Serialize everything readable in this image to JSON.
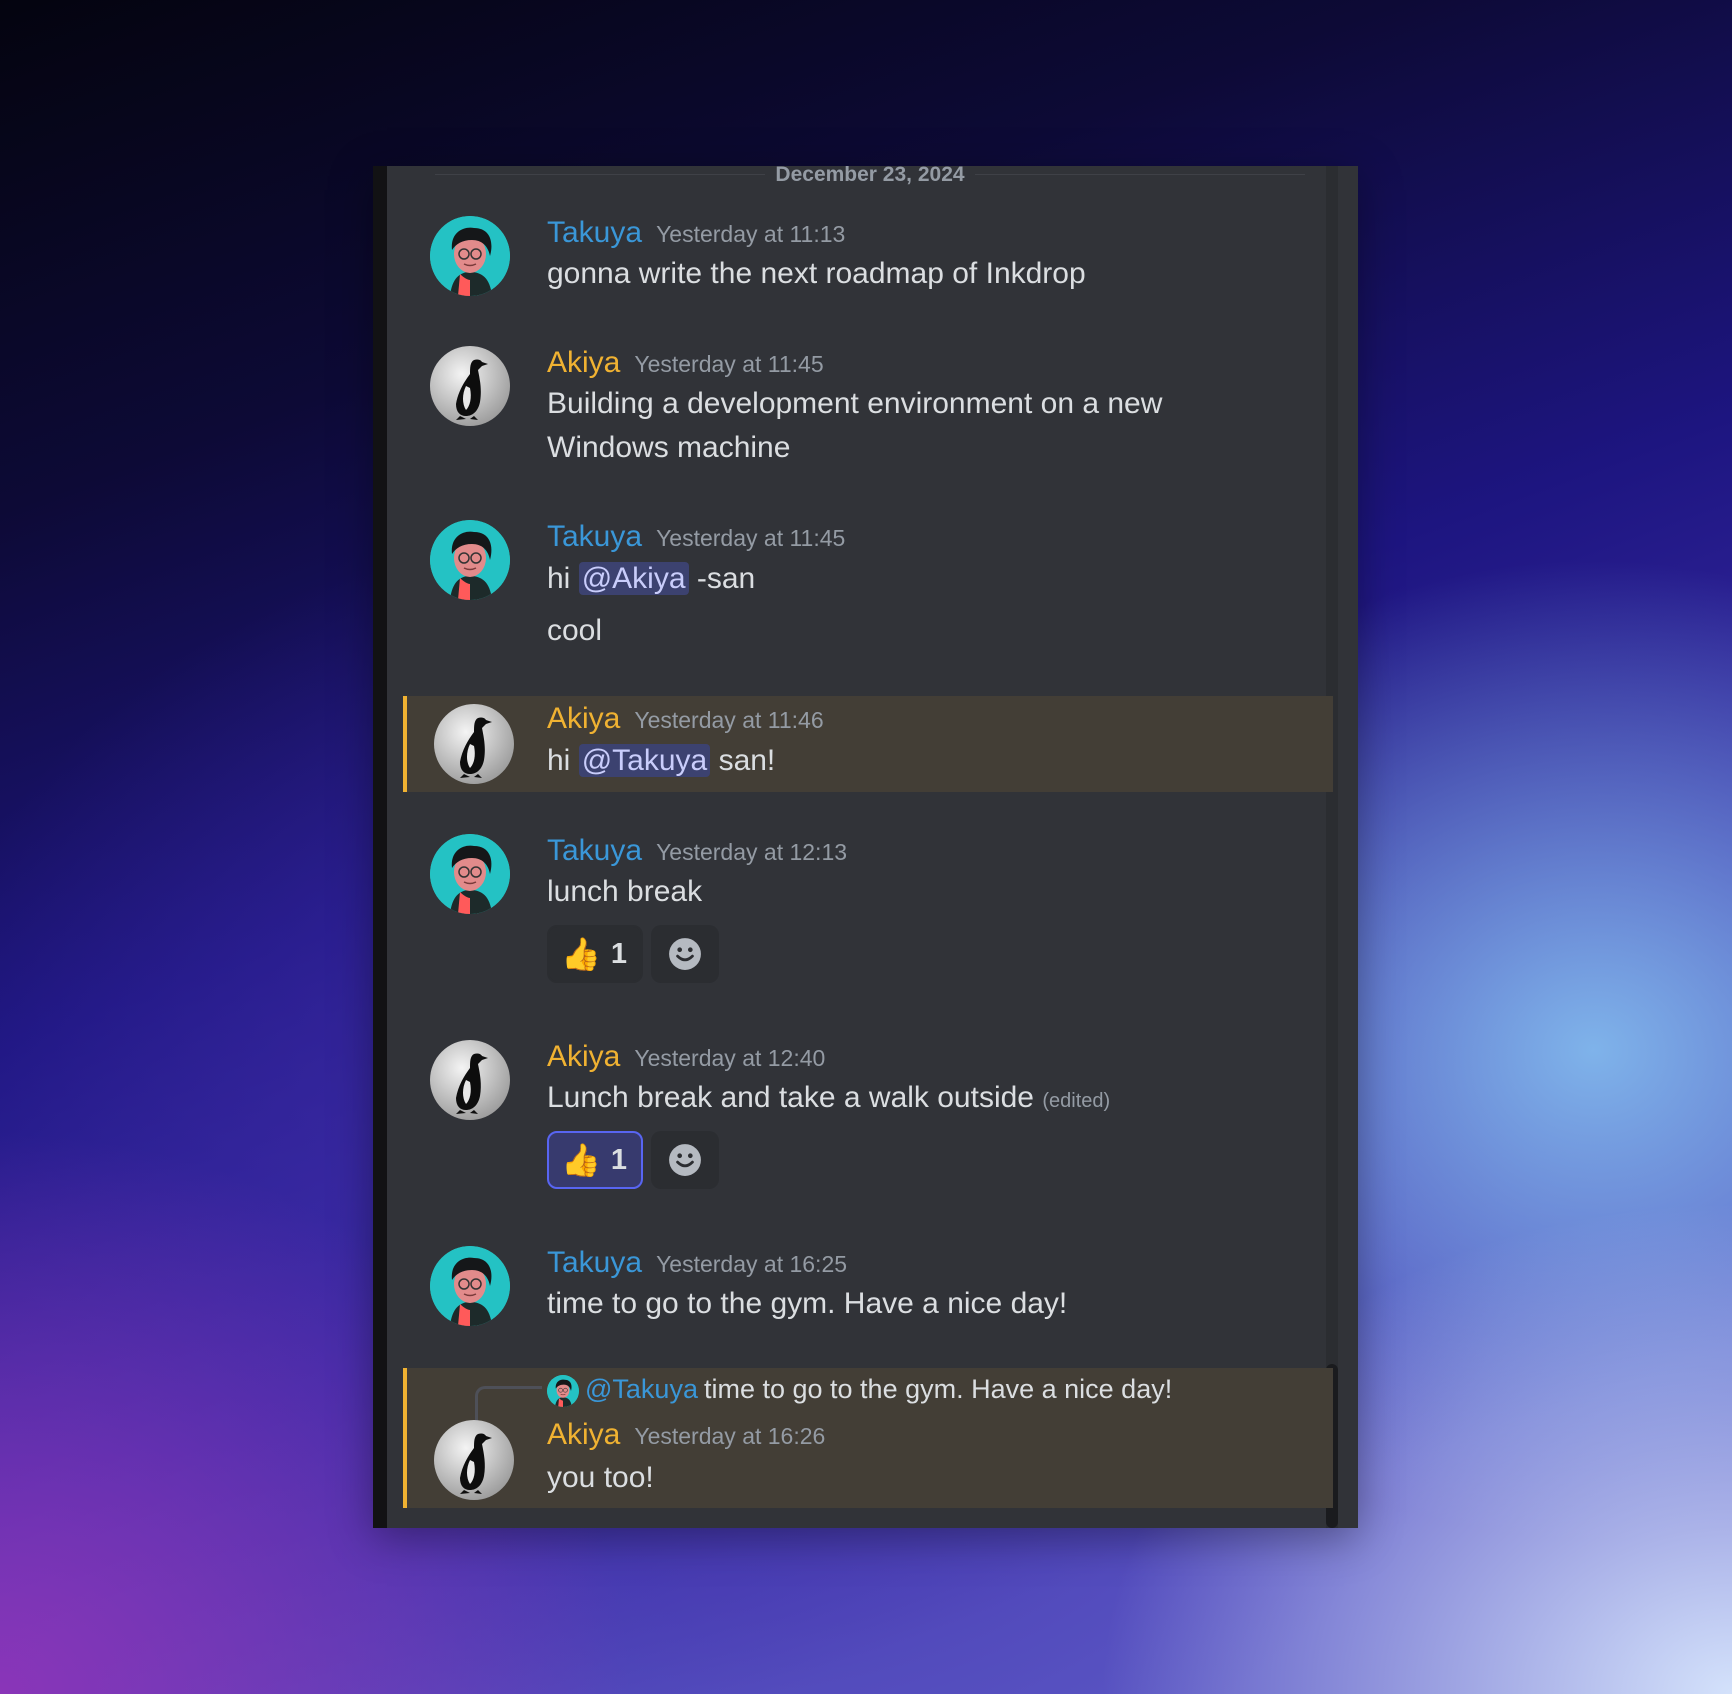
{
  "date_divider": "December 23, 2024",
  "colors": {
    "takuya": "#3a97d8",
    "akiya": "#f0b232",
    "background": "#313338",
    "highlight": "#433e36"
  },
  "messages": [
    {
      "author": "Takuya",
      "timestamp": "Yesterday at 11:13",
      "lines": [
        "gonna write the next roadmap of Inkdrop"
      ]
    },
    {
      "author": "Akiya",
      "timestamp": "Yesterday at 11:45",
      "lines": [
        "Building a development environment on a new",
        "Windows machine"
      ]
    },
    {
      "author": "Takuya",
      "timestamp": "Yesterday at 11:45",
      "line1": {
        "pre": "hi",
        "mention": "@Akiya",
        "post": "-san"
      },
      "line2": "cool"
    },
    {
      "author": "Akiya",
      "timestamp": "Yesterday at 11:46",
      "line1": {
        "pre": "hi",
        "mention": "@Takuya",
        "post": "san!"
      },
      "highlighted": true
    },
    {
      "author": "Takuya",
      "timestamp": "Yesterday at 12:13",
      "lines": [
        "lunch break"
      ],
      "reaction": {
        "emoji": "👍",
        "count": "1",
        "active": false
      }
    },
    {
      "author": "Akiya",
      "timestamp": "Yesterday at 12:40",
      "lines": [
        "Lunch break and take a walk outside"
      ],
      "edited": "(edited)",
      "reaction": {
        "emoji": "👍",
        "count": "1",
        "active": true
      }
    },
    {
      "author": "Takuya",
      "timestamp": "Yesterday at 16:25",
      "lines": [
        "time to go to the gym. Have a nice day!"
      ]
    },
    {
      "author": "Akiya",
      "timestamp": "Yesterday at 16:26",
      "lines": [
        "you too!"
      ],
      "highlighted": true,
      "reply_to": {
        "mention": "@Takuya",
        "text": "time to go to the gym. Have a nice day!"
      }
    }
  ],
  "icons": {
    "avatar_takuya": "avatar-takuya",
    "avatar_akiya": "avatar-penguin",
    "add_reaction": "smiley-add-reaction-icon"
  }
}
